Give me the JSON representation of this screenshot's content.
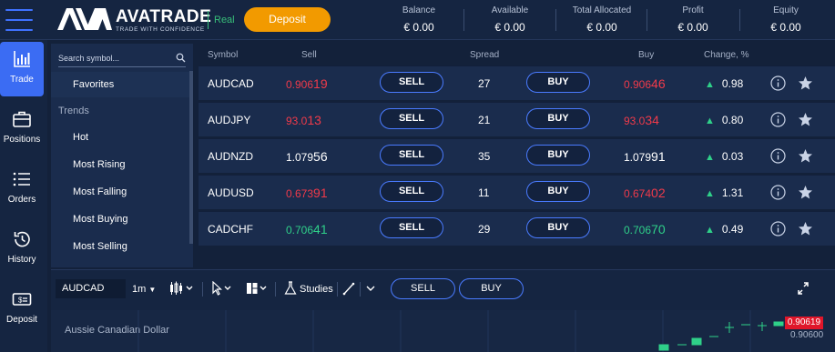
{
  "brand": {
    "name": "AVATRADE",
    "tagline": "TRADE WITH CONFIDENCE"
  },
  "account_mode": "Real",
  "deposit_label": "Deposit",
  "stats": [
    {
      "label": "Balance",
      "value": "€ 0.00"
    },
    {
      "label": "Available",
      "value": "€ 0.00"
    },
    {
      "label": "Total Allocated",
      "value": "€ 0.00"
    },
    {
      "label": "Profit",
      "value": "€ 0.00"
    },
    {
      "label": "Equity",
      "value": "€ 0.00"
    }
  ],
  "nav": [
    {
      "label": "Trade",
      "icon": "chart-icon",
      "active": true
    },
    {
      "label": "Positions",
      "icon": "briefcase-icon"
    },
    {
      "label": "Orders",
      "icon": "list-icon"
    },
    {
      "label": "History",
      "icon": "history-icon"
    },
    {
      "label": "Deposit",
      "icon": "cash-icon"
    }
  ],
  "categories": {
    "search_placeholder": "Search symbol...",
    "favorites": "Favorites",
    "trends_heading": "Trends",
    "items": [
      "Hot",
      "Most Rising",
      "Most Falling",
      "Most Buying",
      "Most Selling"
    ]
  },
  "table": {
    "headers": {
      "symbol": "Symbol",
      "sell": "Sell",
      "spread": "Spread",
      "buy": "Buy",
      "change": "Change, %"
    },
    "sell_label": "SELL",
    "buy_label": "BUY",
    "rows": [
      {
        "symbol": "AUDCAD",
        "sell_a": "0.906",
        "sell_b": "19",
        "sell_color": "red",
        "spread": "27",
        "buy_a": "0.906",
        "buy_b": "46",
        "buy_color": "red",
        "change": "0.98"
      },
      {
        "symbol": "AUDJPY",
        "sell_a": "93.0",
        "sell_b": "13",
        "sell_color": "red",
        "spread": "21",
        "buy_a": "93.0",
        "buy_b": "34",
        "buy_color": "red",
        "change": "0.80"
      },
      {
        "symbol": "AUDNZD",
        "sell_a": "1.079",
        "sell_b": "56",
        "sell_color": "white",
        "spread": "35",
        "buy_a": "1.079",
        "buy_b": "91",
        "buy_color": "white",
        "change": "0.03"
      },
      {
        "symbol": "AUDUSD",
        "sell_a": "0.673",
        "sell_b": "91",
        "sell_color": "red",
        "spread": "11",
        "buy_a": "0.674",
        "buy_b": "02",
        "buy_color": "red",
        "change": "1.31"
      },
      {
        "symbol": "CADCHF",
        "sell_a": "0.706",
        "sell_b": "41",
        "sell_color": "green",
        "spread": "29",
        "buy_a": "0.706",
        "buy_b": "70",
        "buy_color": "green",
        "change": "0.49"
      }
    ]
  },
  "chart": {
    "symbol": "AUDCAD",
    "interval": "1m",
    "studies_label": "Studies",
    "sell_label": "SELL",
    "buy_label": "BUY",
    "title": "Aussie Canadian Dollar",
    "current_price": "0.90619",
    "price_level": "0.90600",
    "colors": {
      "accent": "#3b6cf3",
      "up": "#2fd089",
      "down": "#f03a4a",
      "deposit": "#f29a00"
    }
  }
}
